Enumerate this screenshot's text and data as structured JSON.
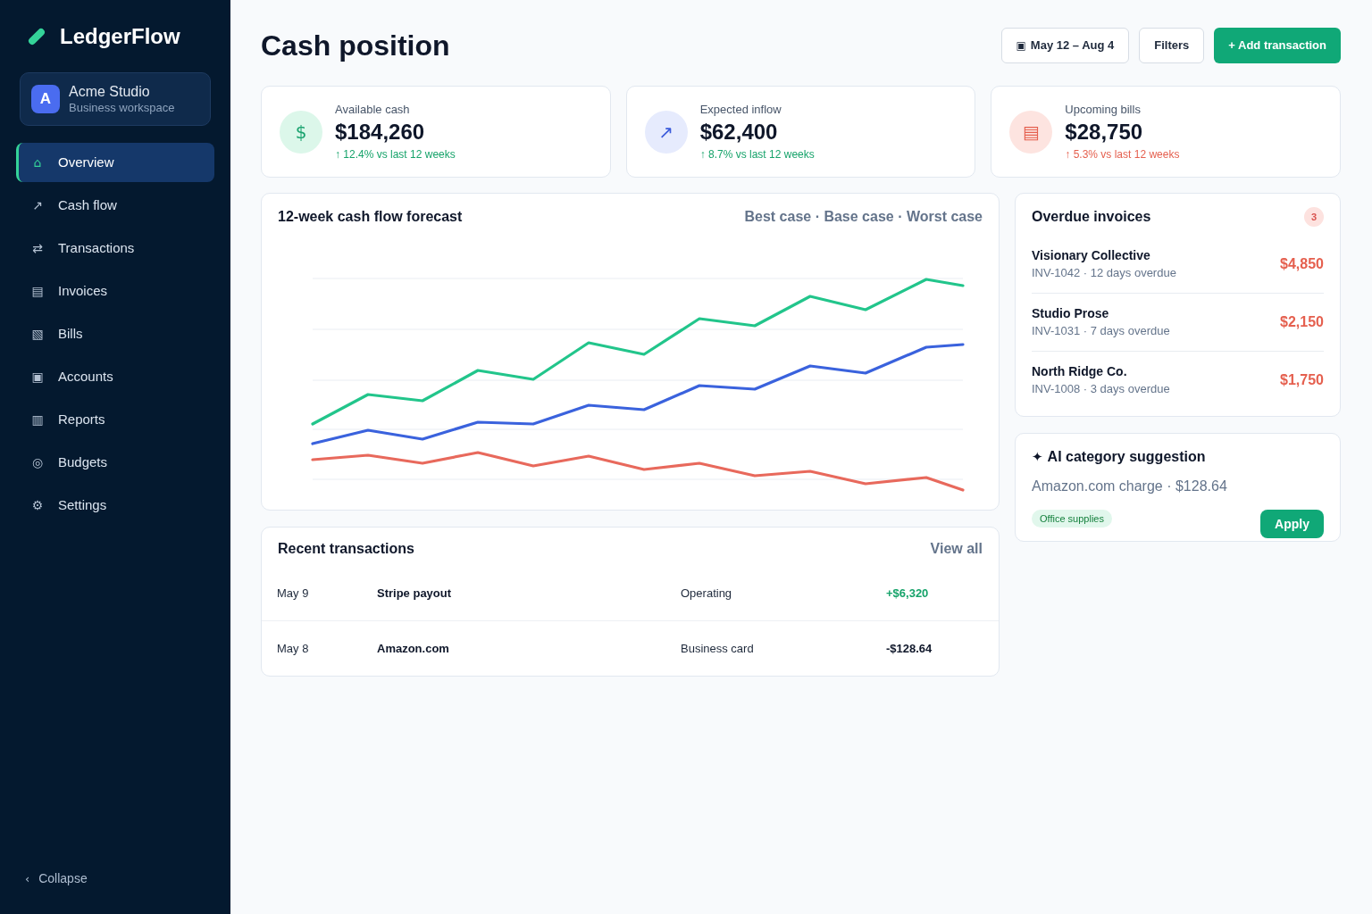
{
  "sidebar": {
    "logo": {
      "name": "LedgerFlow"
    },
    "workspace": {
      "avatar": "A",
      "name": "Acme Studio",
      "subtitle": "Business workspace"
    },
    "nav": [
      {
        "icon": "⌂",
        "label": "Overview",
        "selected": true
      },
      {
        "icon": "↗",
        "label": "Cash flow",
        "selected": false
      },
      {
        "icon": "⇄",
        "label": "Transactions",
        "selected": false
      },
      {
        "icon": "▤",
        "label": "Invoices",
        "selected": false
      },
      {
        "icon": "▧",
        "label": "Bills",
        "selected": false
      },
      {
        "icon": "▣",
        "label": "Accounts",
        "selected": false
      },
      {
        "icon": "▥",
        "label": "Reports",
        "selected": false
      },
      {
        "icon": "◎",
        "label": "Budgets",
        "selected": false
      },
      {
        "icon": "⚙",
        "label": "Settings",
        "selected": false
      }
    ],
    "collapse": {
      "icon": "‹",
      "label": "Collapse"
    }
  },
  "header": {
    "title": "Cash position",
    "date_range": {
      "icon": "▣",
      "label": "May 12 – Aug 4"
    },
    "filters": "Filters",
    "add": "+ Add transaction"
  },
  "kpis": [
    {
      "kind": "success",
      "icon": "$",
      "label": "Available cash",
      "value": "$184,260",
      "trend": {
        "text": "↑ 12.4% vs last 12 weeks",
        "kind": "good"
      }
    },
    {
      "kind": "info",
      "icon": "↗",
      "label": "Expected inflow",
      "value": "$62,400",
      "trend": {
        "text": "↑ 8.7% vs last 12 weeks",
        "kind": "good"
      }
    },
    {
      "kind": "danger",
      "icon": "▤",
      "label": "Upcoming bills",
      "value": "$28,750",
      "trend": {
        "text": "↑ 5.3% vs last 12 weeks",
        "kind": "bad"
      }
    }
  ],
  "forecast": {
    "title": "12-week cash flow forecast",
    "legend": "Best case · Base case · Worst case"
  },
  "transactions": {
    "title": "Recent transactions",
    "view_all": "View all",
    "rows": [
      {
        "date": "May 9",
        "description": "Stripe payout",
        "category": "Operating",
        "amount": "+$6,320",
        "kind": "credit"
      },
      {
        "date": "May 8",
        "description": "Amazon.com",
        "category": "Business card",
        "amount": "-$128.64",
        "kind": "debit"
      }
    ]
  },
  "overdue": {
    "title": "Overdue invoices",
    "count": "3",
    "invoices": [
      {
        "client": "Visionary Collective",
        "meta": "INV-1042 · 12 days overdue",
        "amount": "$4,850"
      },
      {
        "client": "Studio Prose",
        "meta": "INV-1031 · 7 days overdue",
        "amount": "$2,150"
      },
      {
        "client": "North Ridge Co.",
        "meta": "INV-1008 · 3 days overdue",
        "amount": "$1,750"
      }
    ]
  },
  "ai_suggestion": {
    "icon": "✦",
    "title": "AI category suggestion",
    "text": "Amazon.com charge · $128.64",
    "tag": "Office supplies",
    "action": "Apply"
  }
}
